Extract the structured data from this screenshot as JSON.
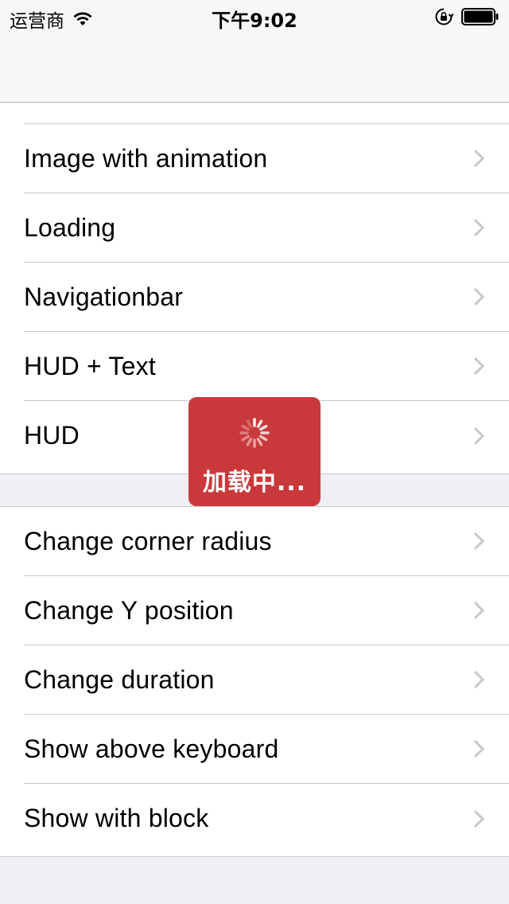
{
  "status_bar": {
    "carrier": "运营商",
    "time": "下午9:02"
  },
  "section_1": {
    "items": [
      {
        "label": "Image with animation"
      },
      {
        "label": "Loading"
      },
      {
        "label": "Navigationbar"
      },
      {
        "label": "HUD + Text"
      },
      {
        "label": "HUD"
      }
    ]
  },
  "section_2": {
    "items": [
      {
        "label": "Change corner radius"
      },
      {
        "label": "Change Y position"
      },
      {
        "label": "Change duration"
      },
      {
        "label": "Show above keyboard"
      },
      {
        "label": "Show with block"
      }
    ]
  },
  "hud": {
    "text": "加载中...",
    "background": "#c9393b"
  },
  "icons": {
    "wifi": "wifi-icon",
    "lock_rotation": "lock-rotation-icon",
    "battery": "battery-icon",
    "chevron": "chevron-right-icon",
    "spinner": "spinner-icon"
  }
}
